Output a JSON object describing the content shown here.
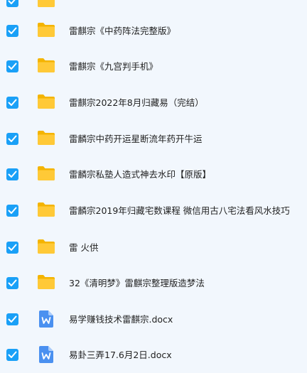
{
  "colors": {
    "background": "#f2f7fd",
    "checkbox": "#1aa0f7",
    "folder": "#ffc937",
    "word_doc": "#4a90f0",
    "text": "#1f1f1f"
  },
  "file_list": {
    "items": [
      {
        "type": "folder",
        "icon": "folder-icon",
        "name": "",
        "checked": true
      },
      {
        "type": "folder",
        "icon": "folder-icon",
        "name": "雷麒宗《中药阵法完整版》",
        "checked": true
      },
      {
        "type": "folder",
        "icon": "folder-icon",
        "name": "雷麒宗《九宫判手机》",
        "checked": true
      },
      {
        "type": "folder",
        "icon": "folder-icon",
        "name": "雷麒宗2022年8月归藏易（完结）",
        "checked": true
      },
      {
        "type": "folder",
        "icon": "folder-icon",
        "name": "雷麟宗中药开运星断流年药开牛运",
        "checked": true
      },
      {
        "type": "folder",
        "icon": "folder-icon",
        "name": "雷麟宗私塾人造式神去水印【原版】",
        "checked": true
      },
      {
        "type": "folder",
        "icon": "folder-icon",
        "name": "雷麟宗2019年归藏宅数课程 微信用古八宅法看风水技巧",
        "checked": true
      },
      {
        "type": "folder",
        "icon": "folder-icon",
        "name": "雷 火供",
        "checked": true
      },
      {
        "type": "folder",
        "icon": "folder-icon",
        "name": "32《清明梦》雷麒宗整理版造梦法",
        "checked": true
      },
      {
        "type": "doc",
        "icon": "word-document-icon",
        "name": "易学赚钱技术雷麒宗.docx",
        "checked": true
      },
      {
        "type": "doc",
        "icon": "word-document-icon",
        "name": "易卦三弄17.6月2日.docx",
        "checked": true
      }
    ]
  }
}
